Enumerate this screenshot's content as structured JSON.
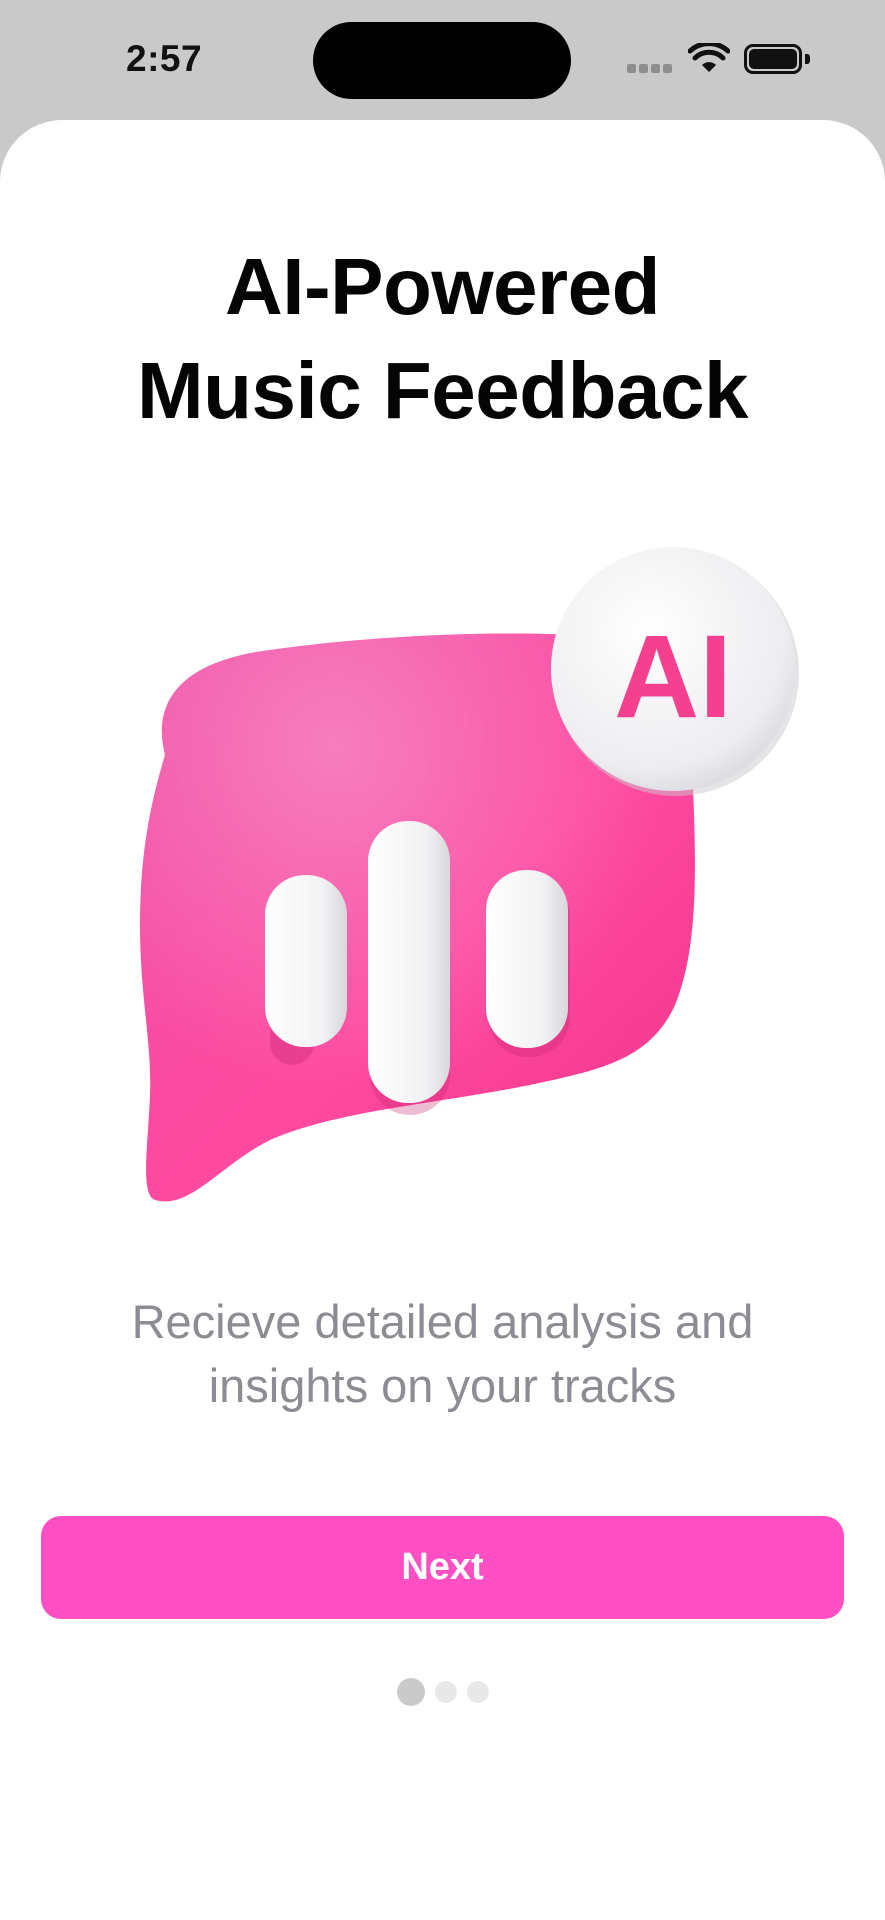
{
  "status_bar": {
    "time": "2:57",
    "icons": [
      "signal-icon",
      "wifi-icon",
      "battery-icon"
    ]
  },
  "onboarding": {
    "title_line1": "AI-Powered",
    "title_line2": "Music Feedback",
    "badge_text": "AI",
    "subtitle_line1": "Recieve detailed analysis and",
    "subtitle_line2": "insights on your tracks",
    "next_label": "Next",
    "page_count": 3,
    "current_page": 1
  },
  "colors": {
    "accent": "#ff4fc3",
    "bubble_pink": "#f0459c",
    "subtitle_gray": "#8c8c93",
    "background_frame": "#c9c9c9"
  }
}
